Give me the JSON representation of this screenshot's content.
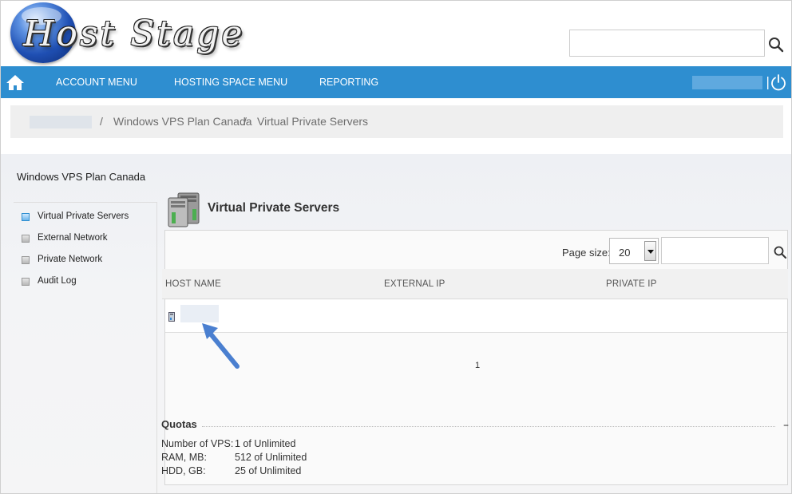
{
  "header": {
    "logo_text": "Host Stage",
    "search_placeholder": ""
  },
  "nav": {
    "items": [
      {
        "label": "ACCOUNT MENU"
      },
      {
        "label": "HOSTING SPACE MENU"
      },
      {
        "label": "REPORTING"
      }
    ]
  },
  "breadcrumb": {
    "items": [
      "Windows VPS Plan Canada",
      "Virtual Private Servers"
    ],
    "separator": "/"
  },
  "sidebar": {
    "title": "Windows VPS Plan Canada",
    "items": [
      {
        "label": "Virtual Private Servers",
        "active": true
      },
      {
        "label": "External Network"
      },
      {
        "label": "Private Network"
      },
      {
        "label": "Audit Log"
      }
    ]
  },
  "main": {
    "title": "Virtual Private Servers",
    "page_size_label": "Page size:",
    "page_size_value": "20",
    "columns": [
      "HOST NAME",
      "EXTERNAL IP",
      "PRIVATE IP"
    ],
    "pager": "1"
  },
  "quotas": {
    "title": "Quotas",
    "toggle": "–",
    "rows": [
      {
        "label": "Number of VPS:",
        "value": "1 of Unlimited"
      },
      {
        "label": "RAM, MB:",
        "value": "512 of Unlimited"
      },
      {
        "label": "HDD, GB:",
        "value": "25 of Unlimited"
      }
    ]
  },
  "colors": {
    "nav_bg": "#2e8ed0",
    "pointer_arrow": "#4a7fd0"
  }
}
